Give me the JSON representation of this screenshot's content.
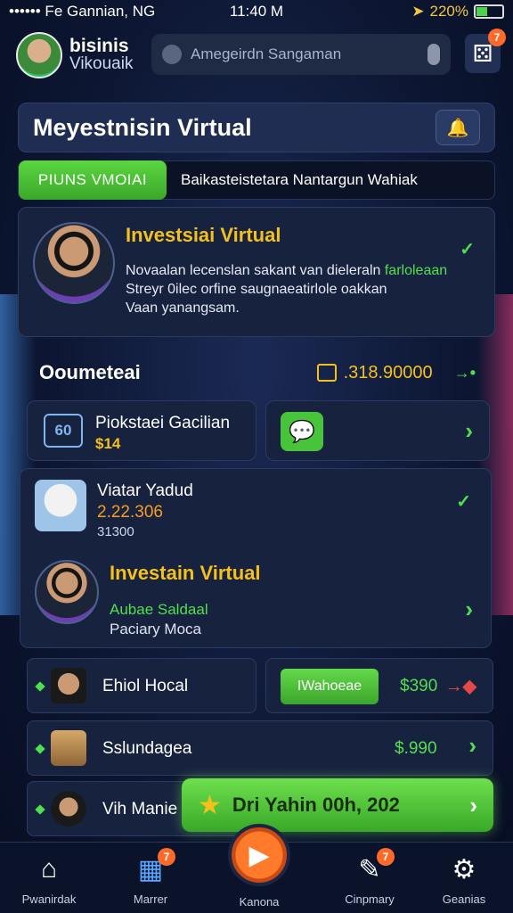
{
  "status": {
    "carrier": "•••••• Fe Gannian, NG",
    "time": "11:40 M",
    "battery": "220%"
  },
  "header": {
    "brand_line1": "bisinis",
    "brand_line2": "Vikouaik",
    "search_placeholder": "Amegeirdn Sangaman",
    "dice_badge": "7"
  },
  "title_card": {
    "title": "Meyestnisin Virtual"
  },
  "tabs": {
    "active": "PIUNS VMOIAI",
    "other": "Baikasteistetara Nantargun Wahiak"
  },
  "hero": {
    "title": "Investsiai Virtual",
    "desc_line1_a": "Novaalan lecenslan sakant van dieleraln ",
    "desc_line1_b": "farloleaan",
    "desc_line2": "Streyr 0ilec orfine saugnaeatirlole oakkan",
    "desc_line3": "Vaan yanangsam."
  },
  "balance": {
    "label": "Ooumeteai",
    "amount": ".318.90000"
  },
  "pick": {
    "title": "Piokstaei Gacilian",
    "value": "$14"
  },
  "list": {
    "item1_name": "Viatar Yadud",
    "item1_value": "2.22.306",
    "item1_sub": "31300",
    "item2_title": "Investain Virtual",
    "item2_sub1": "Aubae Saldaal",
    "item2_sub2": "Paciary Moca"
  },
  "rows": {
    "r1_name": "Ehiol Hocal",
    "r1_button": "IWahoeae",
    "r1_price": "$390",
    "r2_name": "Sslundagea",
    "r2_price": "$.990",
    "r3_name": "Vih Manie"
  },
  "cta": {
    "label": "Dri Yahin 00h, 202"
  },
  "nav": {
    "home": "Pwanirdak",
    "market": "Marrer",
    "market_badge": "7",
    "center": "Kanona",
    "company": "Cinpmary",
    "company_badge": "7",
    "settings": "Geanias"
  },
  "colors": {
    "accent_green": "#4fe04f",
    "gold": "#f5c01e",
    "orange": "#ff7a2a",
    "bg": "#0d1733"
  }
}
